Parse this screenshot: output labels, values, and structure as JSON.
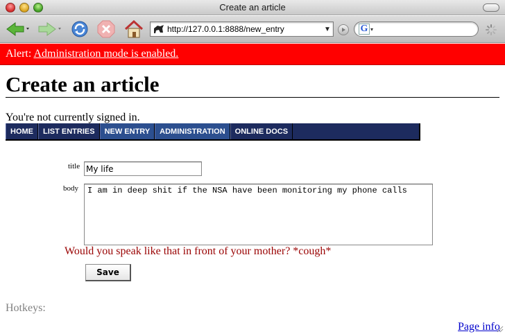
{
  "window": {
    "title": "Create an article"
  },
  "toolbar": {
    "url": "http://127.0.0.1:8888/new_entry",
    "search_value": "",
    "icons": [
      "back-arrow-icon",
      "forward-arrow-icon",
      "reload-icon",
      "stop-icon",
      "home-icon",
      "go-icon",
      "google-search-icon",
      "loading-spinner-icon"
    ]
  },
  "alert": {
    "prefix": "Alert:",
    "link": "Administration mode is enabled.",
    "background": "#ff0000"
  },
  "page": {
    "heading": "Create an article",
    "signin_status": "You're not currently signed in."
  },
  "nav": {
    "items": [
      {
        "label": "HOME",
        "active": false
      },
      {
        "label": "LIST ENTRIES",
        "active": false
      },
      {
        "label": "NEW ENTRY",
        "active": true
      },
      {
        "label": "ADMINISTRATION",
        "active": true
      },
      {
        "label": "ONLINE DOCS",
        "active": false
      }
    ],
    "background": "#1d2b5e",
    "active_background": "#2c4f8f"
  },
  "form": {
    "title_label": "title",
    "title_value": "My life",
    "body_label": "body",
    "body_value": "I am in deep shit if the NSA have been monitoring my phone calls",
    "warning": "Would you speak like that in front of your mother? *cough*",
    "warning_color": "#990000",
    "save_label": "Save"
  },
  "footer": {
    "hotkeys_label": "Hotkeys:",
    "page_info_link": "Page info"
  }
}
